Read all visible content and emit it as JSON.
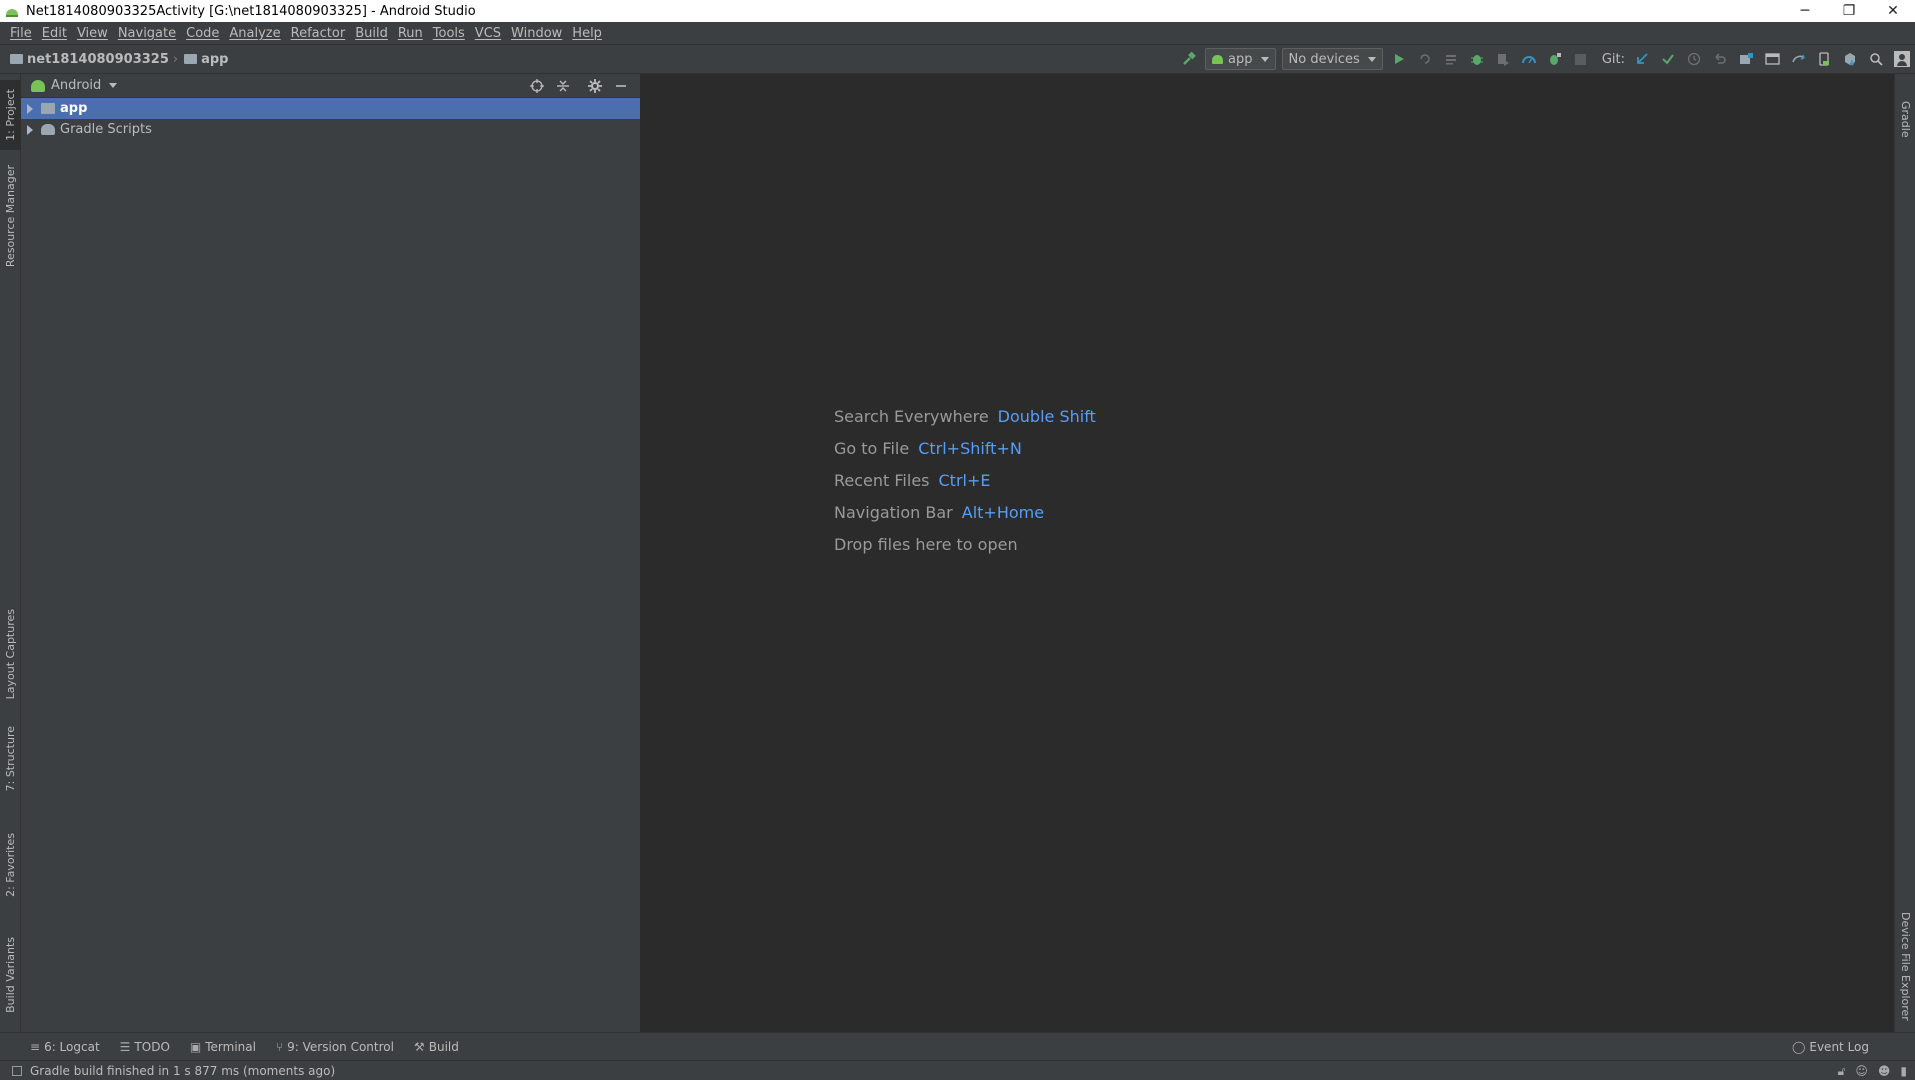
{
  "window": {
    "title": "Net1814080903325Activity [G:\\net1814080903325] - Android Studio",
    "minimize_glyph": "─",
    "restore_glyph": "❐",
    "close_glyph": "✕"
  },
  "menu": [
    "File",
    "Edit",
    "View",
    "Navigate",
    "Code",
    "Analyze",
    "Refactor",
    "Build",
    "Run",
    "Tools",
    "VCS",
    "Window",
    "Help"
  ],
  "breadcrumb": {
    "project": "net1814080903325",
    "module": "app"
  },
  "toolbar": {
    "run_config": "app",
    "device": "No devices",
    "git_label": "Git:"
  },
  "left_tabs": {
    "project": "1: Project",
    "resource_manager": "Resource Manager",
    "layout_captures": "Layout Captures",
    "structure": "7: Structure",
    "favorites": "2: Favorites",
    "build_variants": "Build Variants"
  },
  "right_tabs": {
    "gradle": "Gradle",
    "device_file_explorer": "Device File Explorer"
  },
  "project_panel": {
    "view_mode": "Android",
    "tree": [
      {
        "label": "app",
        "selected": true
      },
      {
        "label": "Gradle Scripts",
        "selected": false
      }
    ]
  },
  "editor_hints": [
    {
      "label": "Search Everywhere",
      "shortcut": "Double Shift"
    },
    {
      "label": "Go to File",
      "shortcut": "Ctrl+Shift+N"
    },
    {
      "label": "Recent Files",
      "shortcut": "Ctrl+E"
    },
    {
      "label": "Navigation Bar",
      "shortcut": "Alt+Home"
    },
    {
      "label": "Drop files here to open",
      "shortcut": ""
    }
  ],
  "bottom_tabs": [
    "6: Logcat",
    "TODO",
    "Terminal",
    "9: Version Control",
    "Build"
  ],
  "event_log": "Event Log",
  "status": {
    "message": "Gradle build finished in 1 s 877 ms (moments ago)"
  },
  "colors": {
    "accent_blue": "#589df6",
    "selection": "#4b6eaf",
    "android_green": "#78c257",
    "run_green": "#59a869"
  }
}
